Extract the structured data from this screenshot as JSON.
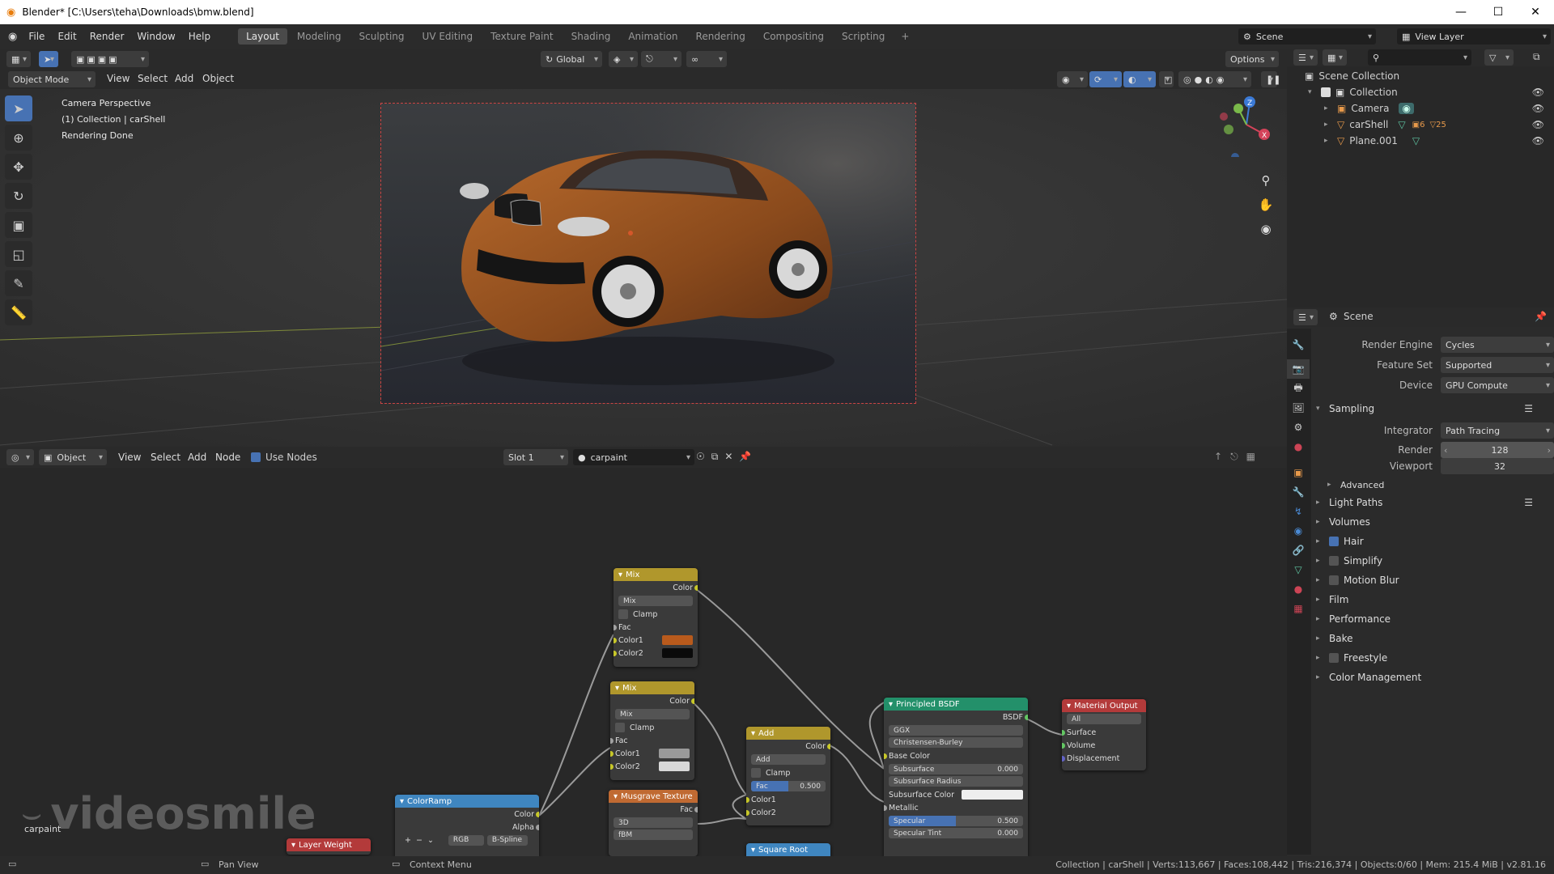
{
  "titlebar": {
    "title": "Blender* [C:\\Users\\teha\\Downloads\\bmw.blend]",
    "minimize": "—",
    "maximize": "☐",
    "close": "✕"
  },
  "menus": [
    "File",
    "Edit",
    "Render",
    "Window",
    "Help"
  ],
  "workspaces": [
    {
      "label": "Layout",
      "active": true
    },
    {
      "label": "Modeling"
    },
    {
      "label": "Sculpting"
    },
    {
      "label": "UV Editing"
    },
    {
      "label": "Texture Paint"
    },
    {
      "label": "Shading"
    },
    {
      "label": "Animation"
    },
    {
      "label": "Rendering"
    },
    {
      "label": "Compositing"
    },
    {
      "label": "Scripting"
    }
  ],
  "add_workspace": "+",
  "scene_selector": "Scene",
  "view_layer_selector": "View Layer",
  "toolrow": {
    "orientation": "Global",
    "options": "Options"
  },
  "viewport_header": {
    "mode": "Object Mode",
    "view": "View",
    "select": "Select",
    "add": "Add",
    "object": "Object"
  },
  "viewport_overlay": {
    "line1": "Camera Perspective",
    "line2": "(1) Collection | carShell",
    "line3": "Rendering Done"
  },
  "gizmo": {
    "z": "Z",
    "y": "Y",
    "x": "X"
  },
  "node_header": {
    "editor": "Object",
    "view": "View",
    "select": "Select",
    "add": "Add",
    "node": "Node",
    "use_nodes": "Use Nodes",
    "slot": "Slot 1",
    "material": "carpaint"
  },
  "outliner": {
    "search_placeholder": "",
    "scene_collection": "Scene Collection",
    "items": [
      {
        "label": "Collection"
      },
      {
        "label": "Camera"
      },
      {
        "label": "carShell"
      },
      {
        "label": "Plane.001"
      }
    ],
    "carshell_badges": [
      "6",
      "25"
    ]
  },
  "properties": {
    "context": "Scene",
    "render_engine_label": "Render Engine",
    "render_engine": "Cycles",
    "feature_set_label": "Feature Set",
    "feature_set": "Supported",
    "device_label": "Device",
    "device": "GPU Compute",
    "sampling": "Sampling",
    "integrator_label": "Integrator",
    "integrator": "Path Tracing",
    "render_label": "Render",
    "render_value": "128",
    "viewport_label": "Viewport",
    "viewport_value": "32",
    "advanced": "Advanced",
    "panels": [
      {
        "label": "Light Paths",
        "check": null
      },
      {
        "label": "Volumes",
        "check": null
      },
      {
        "label": "Hair",
        "check": true
      },
      {
        "label": "Simplify",
        "check": false
      },
      {
        "label": "Motion Blur",
        "check": false
      },
      {
        "label": "Film",
        "check": null
      },
      {
        "label": "Performance",
        "check": null
      },
      {
        "label": "Bake",
        "check": null
      },
      {
        "label": "Freestyle",
        "check": false
      },
      {
        "label": "Color Management",
        "check": null
      }
    ]
  },
  "nodes": {
    "mix1": {
      "title": "Mix",
      "out": "Color",
      "mode": "Mix",
      "clamp": "Clamp",
      "fac": "Fac",
      "c1": "Color1",
      "c2": "Color2"
    },
    "mix2": {
      "title": "Mix",
      "out": "Color",
      "mode": "Mix",
      "clamp": "Clamp",
      "fac": "Fac",
      "c1": "Color1",
      "c2": "Color2"
    },
    "add": {
      "title": "Add",
      "out": "Color",
      "mode": "Add",
      "clamp": "Clamp",
      "fac": "Fac",
      "fac_value": "0.500",
      "c1": "Color1",
      "c2": "Color2"
    },
    "bsdf": {
      "title": "Principled BSDF",
      "out": "BSDF",
      "dist": "GGX",
      "sss": "Christensen-Burley",
      "base": "Base Color",
      "subsurface": "Subsurface",
      "subsurface_val": "0.000",
      "ssr": "Subsurface Radius",
      "ssc": "Subsurface Color",
      "metallic": "Metallic",
      "specular": "Specular",
      "specular_val": "0.500",
      "spec_tint": "Specular Tint",
      "spec_tint_val": "0.000"
    },
    "output": {
      "title": "Material Output",
      "target": "All",
      "surface": "Surface",
      "volume": "Volume",
      "displacement": "Displacement"
    },
    "ramp": {
      "title": "ColorRamp",
      "color": "Color",
      "alpha": "Alpha",
      "mode": "RGB",
      "interp": "B-Spline"
    },
    "musgrave": {
      "title": "Musgrave Texture",
      "fac": "Fac",
      "dim": "3D",
      "type": "fBM"
    },
    "sqrt": {
      "title": "Square Root"
    },
    "layerweight": {
      "title": "Layer Weight"
    }
  },
  "colors": {
    "mix_color1": "#b85a1c",
    "mix_color2": "#0a0a0a",
    "mix2_color1": "#9a9a9a",
    "mix2_color2": "#d8d8d8"
  },
  "node_watermark": "videosmile",
  "node_material_label": "carpaint",
  "statusbar": {
    "pan": "Pan View",
    "context": "Context Menu",
    "stats": "Collection | carShell | Verts:113,667 | Faces:108,442 | Tris:216,374 | Objects:0/60 | Mem: 215.4 MiB | v2.81.16"
  }
}
